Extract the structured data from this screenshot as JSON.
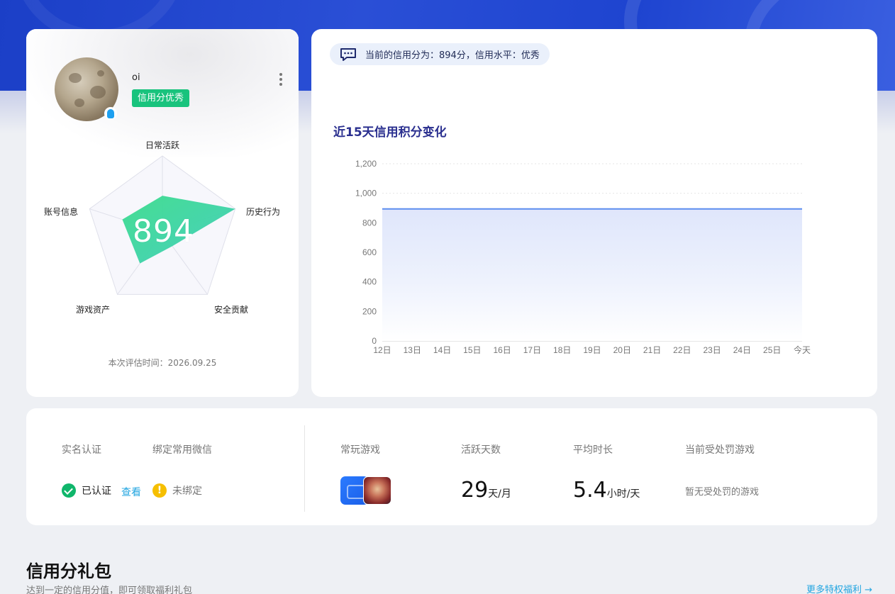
{
  "profile": {
    "username": "oi",
    "credit_tag": "信用分优秀",
    "score": "894",
    "eval_time": "本次评估时间：2026.09.25",
    "radar_labels": [
      "日常活跃",
      "历史行为",
      "安全贡献",
      "游戏资产",
      "账号信息"
    ],
    "radar_values": [
      0.48,
      1.0,
      0.22,
      0.5,
      0.55
    ]
  },
  "status": {
    "text": "当前的信用分为：894分，信用水平：优秀"
  },
  "chart_title": "近15天信用积分变化",
  "chart_data": {
    "type": "area",
    "x": [
      "12日",
      "13日",
      "14日",
      "15日",
      "16日",
      "17日",
      "18日",
      "19日",
      "20日",
      "21日",
      "22日",
      "23日",
      "24日",
      "25日",
      "今天"
    ],
    "series": [
      {
        "values": [
          894,
          894,
          894,
          894,
          894,
          894,
          894,
          894,
          894,
          894,
          894,
          894,
          894,
          894,
          894
        ]
      }
    ],
    "y_ticks": [
      "0",
      "200",
      "400",
      "600",
      "800",
      "1,000",
      "1,200"
    ],
    "ylim": [
      0,
      1200
    ],
    "grid": true,
    "colors": {
      "line": "#5b8def",
      "fill": "#e3e9fb"
    }
  },
  "info": {
    "real_name_label": "实名认证",
    "wechat_label": "绑定常用微信",
    "verified_text": "已认证",
    "view_link": "查看",
    "unbound_text": "未绑定",
    "games_label": "常玩游戏",
    "active_days_label": "活跃天数",
    "active_days_value": "29",
    "active_days_unit": "天/月",
    "avg_time_label": "平均时长",
    "avg_time_value": "5.4",
    "avg_time_unit": "小时/天",
    "penalty_label": "当前受处罚游戏",
    "penalty_value": "暂无受处罚的游戏"
  },
  "gift": {
    "title": "信用分礼包",
    "subtitle": "达到一定的信用分值，即可领取福利礼包",
    "more_link": "更多特权福利 →"
  }
}
